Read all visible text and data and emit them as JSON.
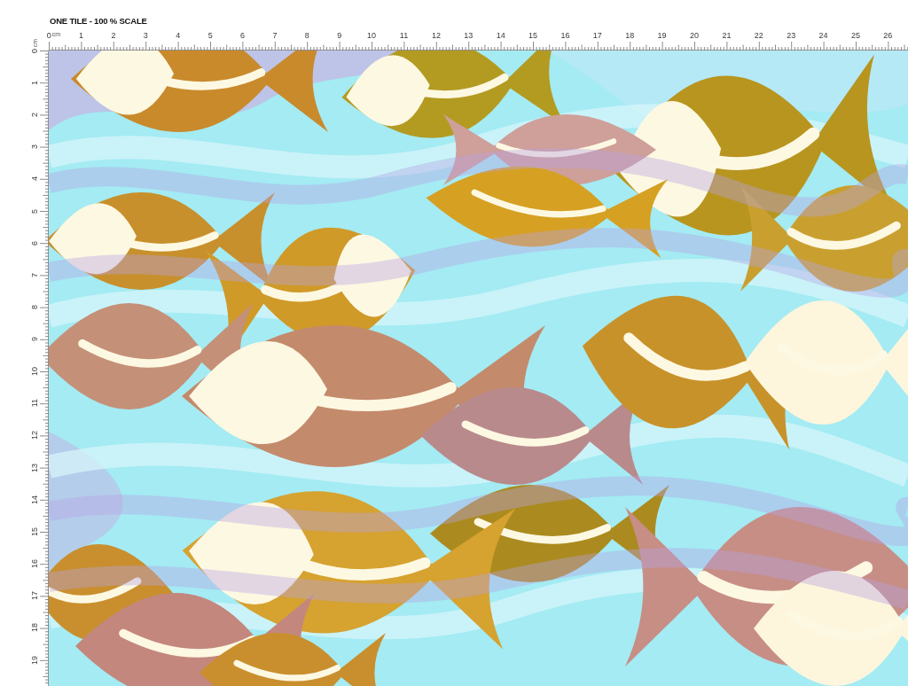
{
  "title": "ONE TILE - 100 % SCALE",
  "top_ruler": {
    "unit": "cm",
    "labels": [
      "0",
      "1",
      "2",
      "3",
      "4",
      "5",
      "6",
      "7",
      "8",
      "9",
      "10",
      "11",
      "12",
      "13",
      "14",
      "15",
      "16",
      "17",
      "18",
      "19",
      "20",
      "21",
      "22",
      "23",
      "24",
      "25",
      "26"
    ]
  },
  "left_ruler": {
    "unit": "cm",
    "labels": [
      "0",
      "1",
      "2",
      "3",
      "4",
      "5",
      "6",
      "7",
      "8",
      "9",
      "10",
      "11",
      "12",
      "13",
      "14",
      "15",
      "16",
      "17",
      "18",
      "19"
    ]
  }
}
